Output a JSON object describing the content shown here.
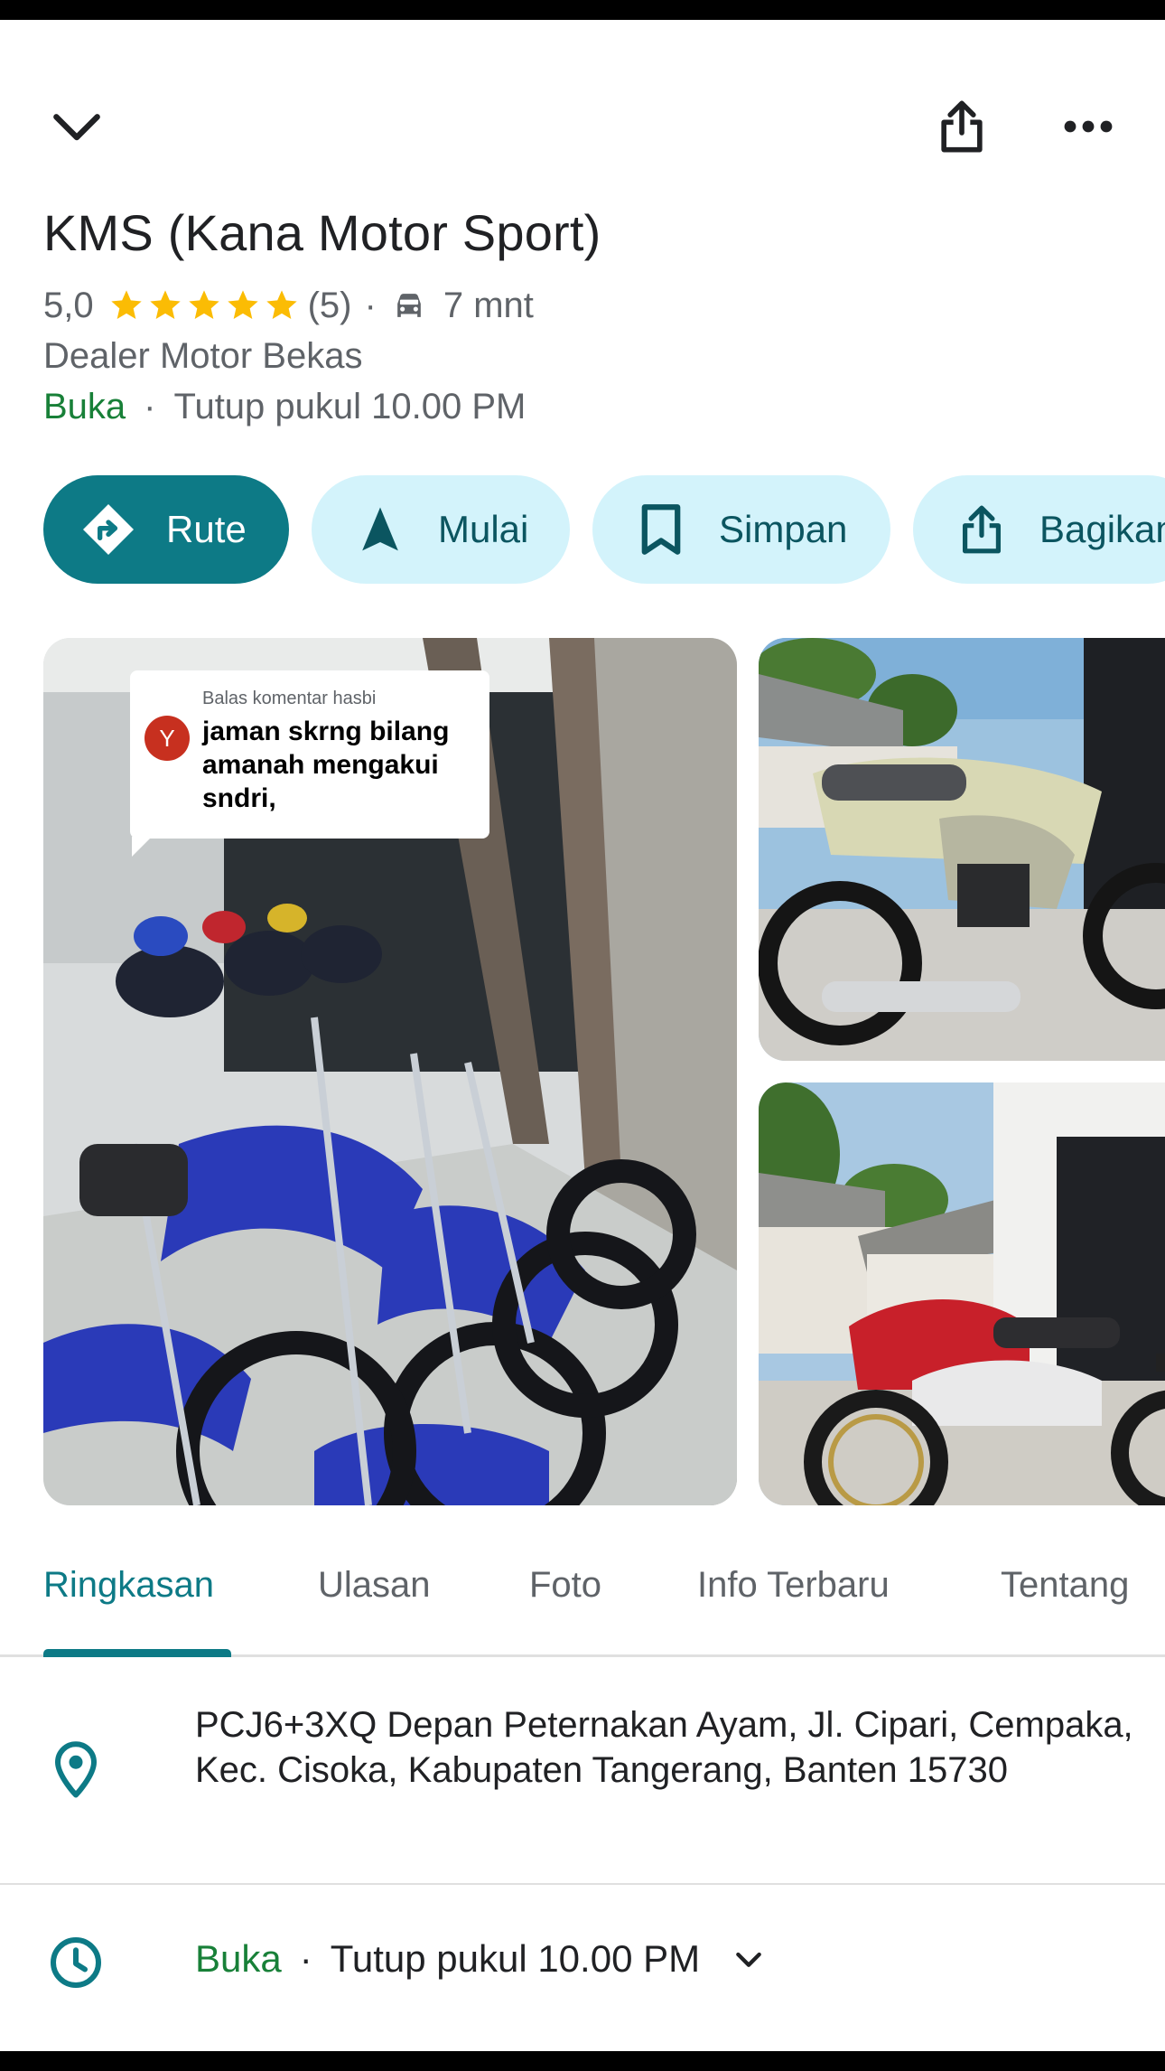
{
  "header": {
    "back_icon": "chevron-down-icon",
    "share_icon": "share-icon",
    "more_icon": "more-horizontal-icon"
  },
  "place": {
    "name": "KMS (Kana Motor Sport)",
    "rating": "5,0",
    "stars": 5,
    "review_count": "(5)",
    "dot": "·",
    "travel_time": "7 mnt",
    "category": "Dealer Motor Bekas",
    "status": "Buka",
    "status_dot": "·",
    "closing": "Tutup pukul 10.00 PM"
  },
  "actions": [
    {
      "label": "Rute",
      "icon": "directions-icon"
    },
    {
      "label": "Mulai",
      "icon": "navigation-arrow-icon"
    },
    {
      "label": "Simpan",
      "icon": "bookmark-icon"
    },
    {
      "label": "Bagikan",
      "icon": "share-icon"
    }
  ],
  "photos": {
    "comment": {
      "avatar_letter": "Y",
      "meta": "Balas komentar hasbi",
      "text": "jaman skrng bilang amanah mengakui sndri,"
    }
  },
  "tabs": [
    {
      "label": "Ringkasan",
      "active": true
    },
    {
      "label": "Ulasan",
      "active": false
    },
    {
      "label": "Foto",
      "active": false
    },
    {
      "label": "Info Terbaru",
      "active": false
    },
    {
      "label": "Tentang",
      "active": false
    }
  ],
  "details": {
    "address": "PCJ6+3XQ Depan Peternakan Ayam, Jl. Cipari, Cempaka, Kec. Cisoka, Kabupaten Tangerang, Banten 15730",
    "hours_status": "Buka",
    "hours_dot": "·",
    "hours_closing": "Tutup pukul 10.00 PM"
  },
  "colors": {
    "accent": "#0d7a86",
    "chip_bg": "#d3f3fb",
    "open_green": "#188038",
    "star": "#fbbc04"
  }
}
